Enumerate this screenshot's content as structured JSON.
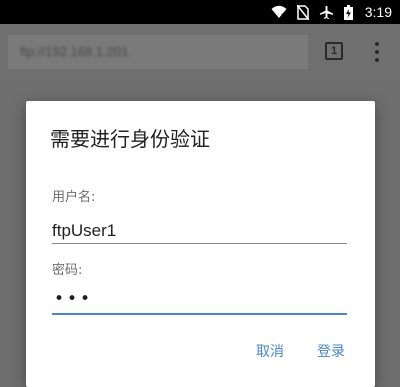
{
  "status_bar": {
    "time": "3:19",
    "icons": [
      "wifi-icon",
      "no-sim-icon",
      "airplane-mode-icon",
      "battery-charging-icon"
    ]
  },
  "browser": {
    "url": "ftp://192.168.1.201",
    "tab_count": "1",
    "icons": [
      "tab-switcher-icon",
      "overflow-menu-icon"
    ]
  },
  "dialog": {
    "title": "需要进行身份验证",
    "username_label": "用户名:",
    "username_value": "ftpUser1",
    "password_label": "密码:",
    "password_mask": "•••",
    "cancel_label": "取消",
    "login_label": "登录"
  },
  "colors": {
    "accent": "#4a86c8",
    "scrim": "#6e6e6e"
  }
}
